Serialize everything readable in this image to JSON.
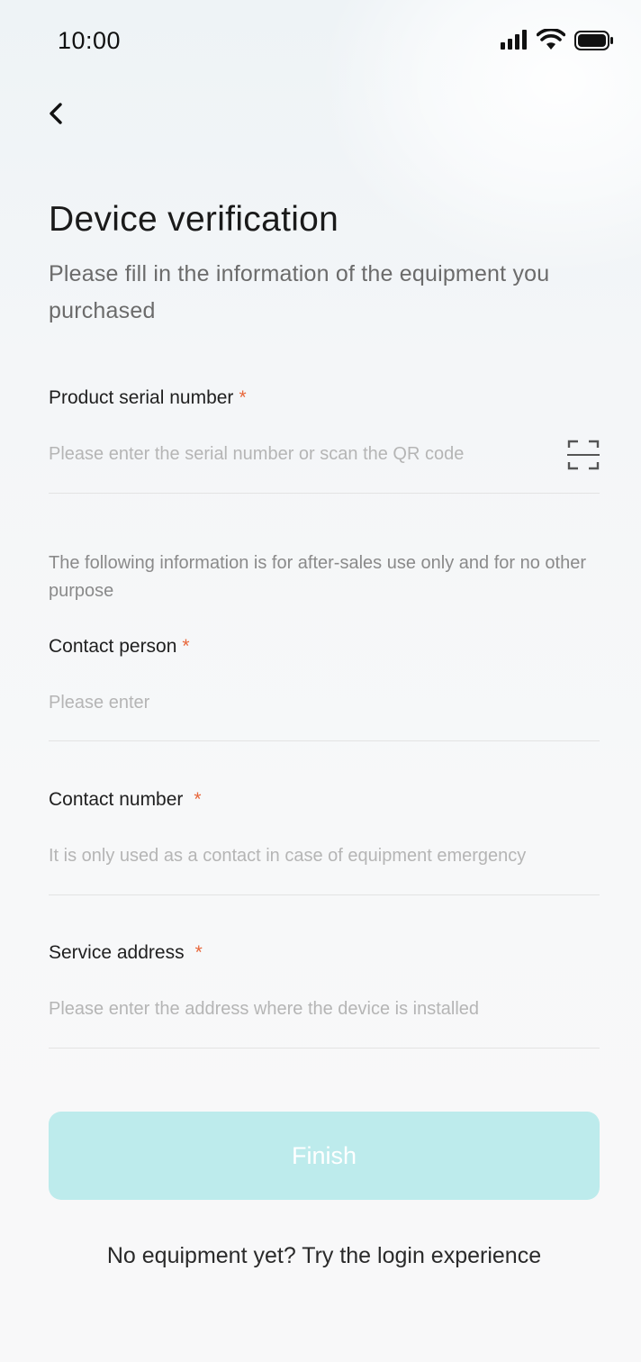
{
  "status_bar": {
    "time": "10:00",
    "icons": [
      "signal-icon",
      "wifi-icon",
      "battery-icon"
    ]
  },
  "header": {
    "back_icon": "chevron-left-icon"
  },
  "page": {
    "title": "Device verification",
    "subtitle": "Please fill in the information of the equipment you  purchased"
  },
  "form": {
    "serial": {
      "label": "Product serial number",
      "required_mark": "*",
      "placeholder": "Please enter the serial number or scan the QR code",
      "value": "",
      "scan_icon": "scan-qr-icon"
    },
    "notice": "The following information is for after-sales use only and for no other purpose",
    "contact_person": {
      "label": "Contact person",
      "required_mark": "*",
      "placeholder": "Please enter",
      "value": ""
    },
    "contact_number": {
      "label": "Contact number",
      "required_mark": "*",
      "placeholder": "It is only used as a contact in case of equipment emergency",
      "value": ""
    },
    "service_address": {
      "label": "Service address",
      "required_mark": "*",
      "placeholder": "Please enter the address where the device is installed",
      "value": ""
    }
  },
  "actions": {
    "finish_label": "Finish",
    "login_link": "No equipment yet? Try the login experience"
  },
  "colors": {
    "accent_disabled": "#bdebec",
    "required": "#e8673b",
    "title": "#1a1a1a",
    "placeholder": "#b5b5b5"
  }
}
